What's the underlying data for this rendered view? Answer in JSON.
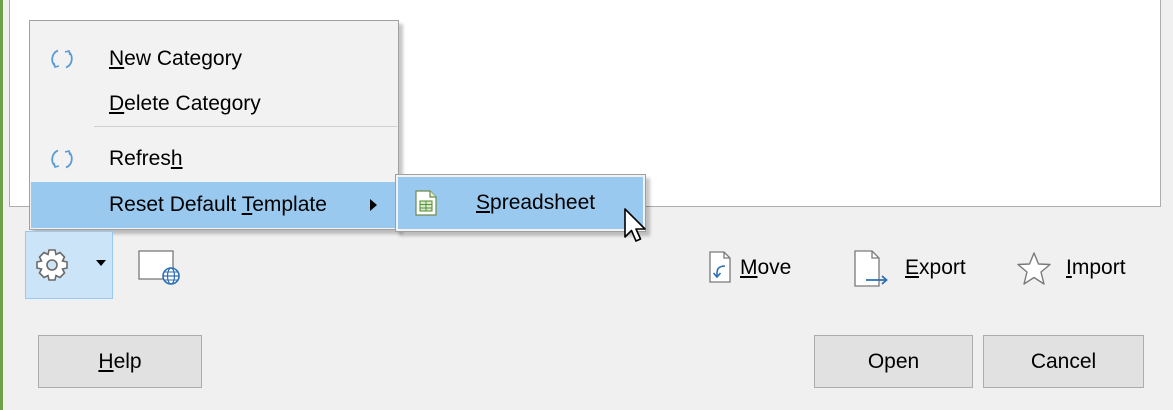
{
  "menu": {
    "items": [
      {
        "pre": "",
        "mnemonic": "N",
        "post": "ew Category",
        "icon": "refresh-icon"
      },
      {
        "pre": "",
        "mnemonic": "D",
        "post": "elete Category",
        "icon": ""
      },
      {
        "pre": "Refres",
        "mnemonic": "h",
        "post": "",
        "icon": "refresh-icon"
      },
      {
        "pre": "Reset Default ",
        "mnemonic": "T",
        "post": "emplate",
        "icon": "submenu-arrow-icon"
      }
    ]
  },
  "submenu": {
    "items": [
      {
        "pre": "",
        "mnemonic": "S",
        "post": "preadsheet",
        "icon": "spreadsheet-icon"
      }
    ]
  },
  "toolbar": {
    "settings_icon": "gear-icon",
    "online_icon": "globe-document-icon",
    "move": {
      "pre": "",
      "mnemonic": "M",
      "post": "ove"
    },
    "export": {
      "pre": "",
      "mnemonic": "E",
      "post": "xport"
    },
    "import": {
      "pre": "",
      "mnemonic": "I",
      "post": "mport"
    }
  },
  "buttons": {
    "help": {
      "pre": "",
      "mnemonic": "H",
      "post": "elp"
    },
    "open": "Open",
    "cancel": "Cancel"
  },
  "colors": {
    "highlight": "#99c9ef",
    "pressed": "#cce4f7",
    "accent_green": "#6ca04a"
  }
}
